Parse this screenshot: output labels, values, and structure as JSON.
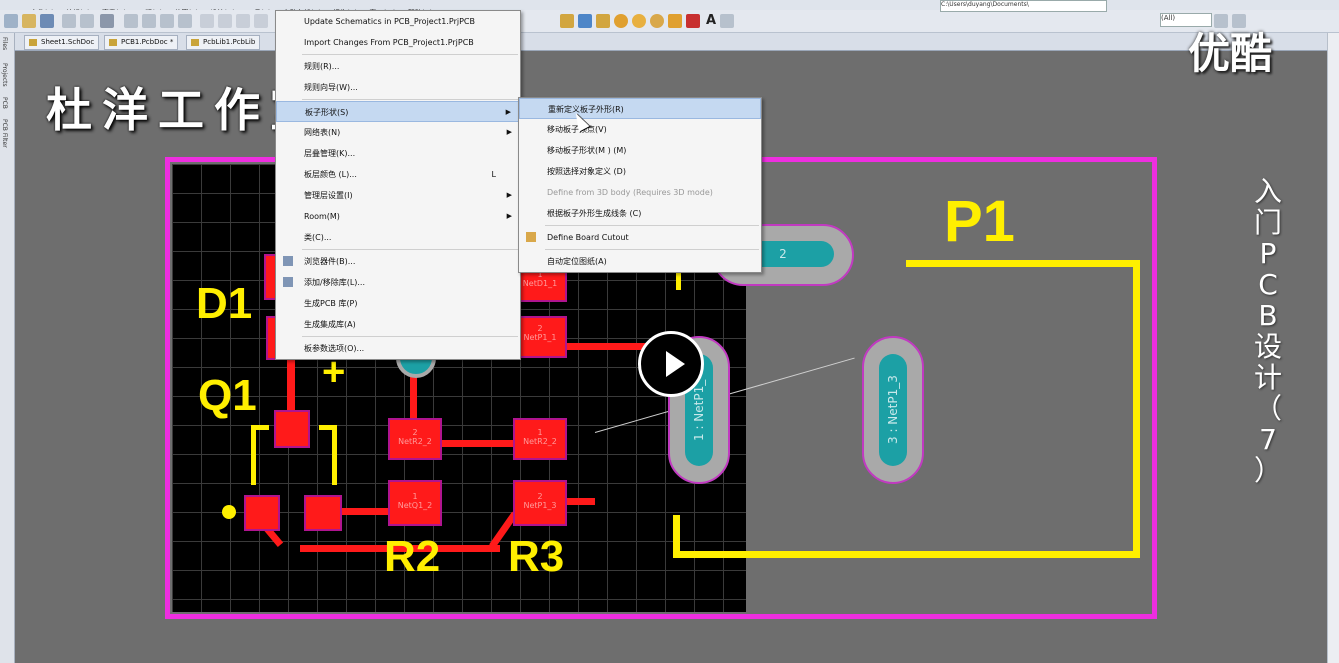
{
  "menubar": {
    "items": [
      "DXP",
      "文件(F)",
      "编辑(E)",
      "察看(V)",
      "工程(C)",
      "放置(P)",
      "设计(D)",
      "工具(T)",
      "自动布线(A)",
      "报告(R)",
      "窗口(W)",
      "帮助(H)"
    ]
  },
  "toolbar": {
    "path_value": "C:\\Users\\duyang\\Documents\\",
    "filter_value": "(All)"
  },
  "tabs": [
    "Sheet1.SchDoc",
    "PCB1.PcbDoc *",
    "PcbLib1.PcbLib"
  ],
  "left_panels": [
    "Files",
    "Projects",
    "PCB",
    "PCB Filter"
  ],
  "overlay": {
    "studio_name": "杜洋工作室",
    "logo": "优酷",
    "vertical_title": [
      "入",
      "门",
      "P",
      "C",
      "B",
      "设",
      "计",
      "（",
      "7",
      "）"
    ]
  },
  "design_menu": {
    "items": [
      {
        "label": "Update Schematics in PCB_Project1.PrjPCB",
        "submenu": false
      },
      {
        "label": "Import Changes From PCB_Project1.PrjPCB",
        "submenu": false
      },
      {
        "sep": true
      },
      {
        "label": "规则(R)...",
        "submenu": false
      },
      {
        "label": "规则向导(W)...",
        "submenu": false
      },
      {
        "sep": true
      },
      {
        "label": "板子形状(S)",
        "submenu": true,
        "highlight": true
      },
      {
        "label": "网络表(N)",
        "submenu": true
      },
      {
        "label": "层叠管理(K)...",
        "submenu": false
      },
      {
        "label": "板层颜色 (L)...",
        "shortcut": "L",
        "submenu": false
      },
      {
        "label": "管理层设置(I)",
        "submenu": true
      },
      {
        "label": "Room(M)",
        "submenu": true
      },
      {
        "label": "类(C)...",
        "submenu": false
      },
      {
        "sep": true
      },
      {
        "label": "浏览器件(B)...",
        "submenu": false,
        "icon": true
      },
      {
        "label": "添加/移除库(L)...",
        "submenu": false,
        "icon": true
      },
      {
        "label": "生成PCB 库(P)",
        "submenu": false
      },
      {
        "label": "生成集成库(A)",
        "submenu": false
      },
      {
        "sep": true
      },
      {
        "label": "板参数选项(O)...",
        "submenu": false
      }
    ]
  },
  "board_shape_submenu": {
    "items": [
      {
        "label": "重新定义板子外形(R)",
        "highlight": true
      },
      {
        "label": "移动板子顶点(V)"
      },
      {
        "label": "移动板子形状(M ) (M)"
      },
      {
        "label": "按照选择对象定义 (D)"
      },
      {
        "label": "Define from 3D body (Requires 3D mode)",
        "disabled": true
      },
      {
        "label": "根据板子外形生成线条 (C)"
      },
      {
        "sep": true
      },
      {
        "label": "Define Board Cutout",
        "icon": true
      },
      {
        "sep": true
      },
      {
        "label": "自动定位图纸(A)"
      }
    ]
  },
  "pcb": {
    "designators": {
      "d1": "D1",
      "q1": "Q1",
      "r2": "R2",
      "r3": "R3",
      "p1": "P1",
      "plus": "+"
    },
    "pads": [
      {
        "num": "1",
        "net": "NetD1_1"
      },
      {
        "num": "2",
        "net": "NetP1_1"
      },
      {
        "num": "2",
        "net": "NetR2_2"
      },
      {
        "num": "1",
        "net": "NetR2_2"
      },
      {
        "num": "1",
        "net": "NetQ1_2"
      },
      {
        "num": "2",
        "net": "NetP1_3"
      }
    ],
    "connector_pads": [
      {
        "label": "2"
      },
      {
        "label": "1 : NetP1_"
      },
      {
        "label": "3 : NetP1_3"
      }
    ]
  }
}
